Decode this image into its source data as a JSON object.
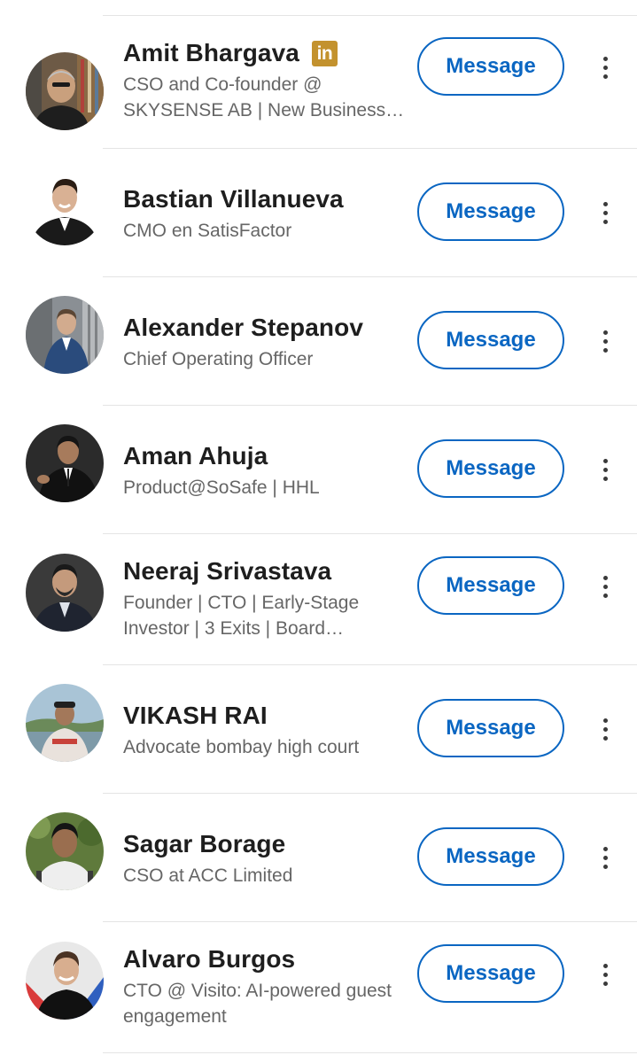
{
  "connections": [
    {
      "name": "Amit Bhargava",
      "badge": "in",
      "headline": "CSO and Co-founder @ SKYSENSE AB | New Business…",
      "button_label": "Message",
      "avatar": {
        "bg": "#6d5a46",
        "skin": "#c9a07d",
        "shirt": "#1e1e1e",
        "hair": "#bfbfbf"
      }
    },
    {
      "name": "Bastian Villanueva",
      "headline": "CMO en SatisFactor",
      "button_label": "Message",
      "avatar": {
        "bg": "#ffffff",
        "skin": "#d9b194",
        "shirt": "#1a1a1a",
        "hair": "#2a1d14"
      }
    },
    {
      "name": "Alexander Stepanov",
      "headline": "Chief Operating Officer",
      "button_label": "Message",
      "avatar": {
        "bg": "#8a8f94",
        "skin": "#d2ab8e",
        "shirt": "#2a4b7c",
        "hair": "#5b4634"
      }
    },
    {
      "name": "Aman Ahuja",
      "headline": "Product@SoSafe | HHL",
      "button_label": "Message",
      "avatar": {
        "bg": "#2b2b2b",
        "skin": "#a77b5c",
        "shirt": "#111111",
        "hair": "#151515"
      }
    },
    {
      "name": "Neeraj Srivastava",
      "headline": "Founder | CTO | Early-Stage Investor | 3 Exits | Board…",
      "button_label": "Message",
      "avatar": {
        "bg": "#3a3a3a",
        "skin": "#c49a7c",
        "shirt": "#1f2430",
        "hair": "#1a1a1a"
      }
    },
    {
      "name": "VIKASH RAI",
      "headline": "Advocate bombay high court",
      "button_label": "Message",
      "avatar": {
        "bg": "#a9c4d6",
        "skin": "#a3785a",
        "shirt": "#e9e2dc",
        "hair": "#202020"
      }
    },
    {
      "name": "Sagar Borage",
      "headline": "CSO at ACC Limited",
      "button_label": "Message",
      "avatar": {
        "bg": "#5f7a3c",
        "skin": "#9a6e4f",
        "shirt": "#eeeeee",
        "hair": "#151515"
      }
    },
    {
      "name": "Alvaro Burgos",
      "headline": "CTO @ Visito: AI-powered guest engagement",
      "button_label": "Message",
      "avatar": {
        "bg": "#e8e8e8",
        "skin": "#d8ae8f",
        "shirt": "#111111",
        "hair": "#4a3324",
        "accent": "#d93b3b",
        "accent2": "#2f5fbf"
      }
    }
  ]
}
